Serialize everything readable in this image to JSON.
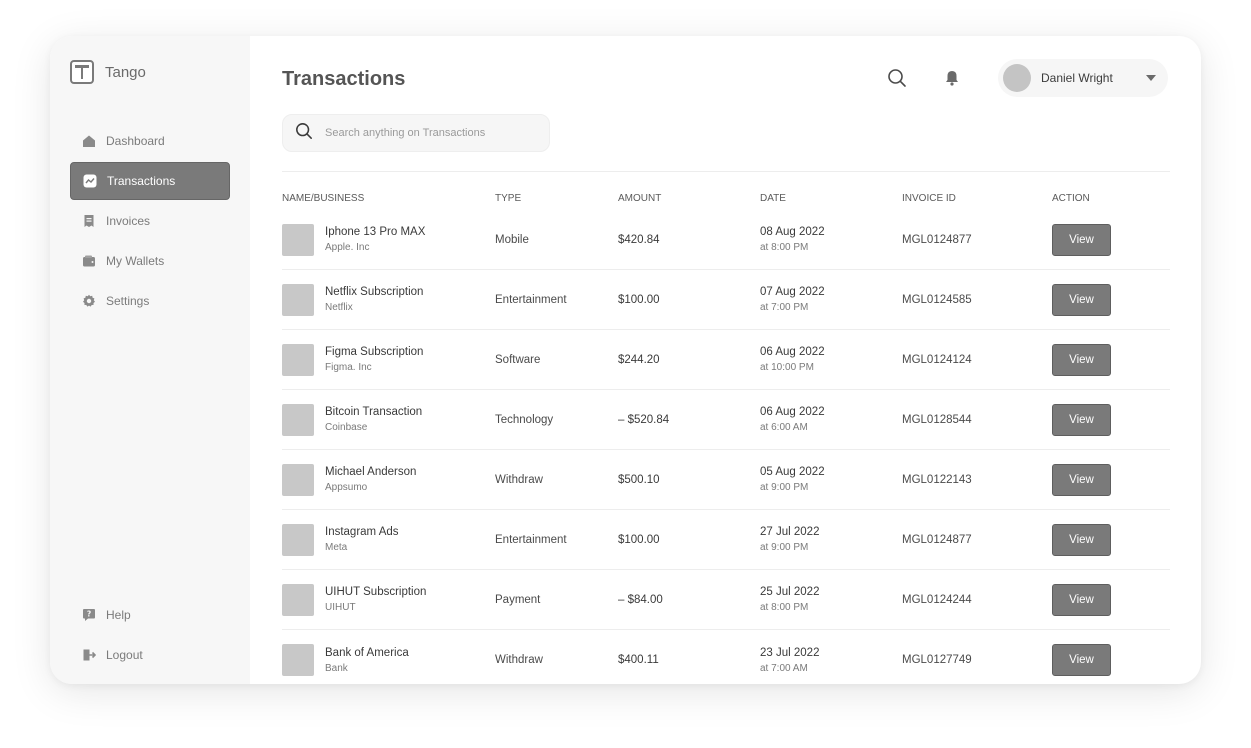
{
  "brand": {
    "name": "Tango"
  },
  "nav": {
    "items": [
      {
        "label": "Dashboard",
        "icon": "home-icon",
        "active": false
      },
      {
        "label": "Transactions",
        "icon": "trend-icon",
        "active": true
      },
      {
        "label": "Invoices",
        "icon": "receipt-icon",
        "active": false
      },
      {
        "label": "My Wallets",
        "icon": "wallet-icon",
        "active": false
      },
      {
        "label": "Settings",
        "icon": "gear-icon",
        "active": false
      }
    ],
    "bottom": [
      {
        "label": "Help",
        "icon": "help-icon"
      },
      {
        "label": "Logout",
        "icon": "logout-icon"
      }
    ]
  },
  "header": {
    "title": "Transactions",
    "user_name": "Daniel Wright"
  },
  "search": {
    "placeholder": "Search anything on Transactions",
    "value": ""
  },
  "table": {
    "headers": [
      "NAME/BUSINESS",
      "TYPE",
      "AMOUNT",
      "DATE",
      "INVOICE ID",
      "ACTION"
    ],
    "action_label": "View",
    "rows": [
      {
        "name": "Iphone 13 Pro MAX",
        "business": "Apple. Inc",
        "type": "Mobile",
        "amount": "$420.84",
        "date": "08 Aug 2022",
        "time": "at 8:00 PM",
        "invoice": "MGL0124877"
      },
      {
        "name": "Netflix Subscription",
        "business": "Netflix",
        "type": "Entertainment",
        "amount": "$100.00",
        "date": "07 Aug 2022",
        "time": "at 7:00 PM",
        "invoice": "MGL0124585"
      },
      {
        "name": "Figma Subscription",
        "business": "Figma. Inc",
        "type": "Software",
        "amount": "$244.20",
        "date": "06 Aug 2022",
        "time": "at 10:00 PM",
        "invoice": "MGL0124124"
      },
      {
        "name": "Bitcoin Transaction",
        "business": "Coinbase",
        "type": "Technology",
        "amount": "– $520.84",
        "date": "06 Aug 2022",
        "time": "at 6:00 AM",
        "invoice": "MGL0128544"
      },
      {
        "name": "Michael Anderson",
        "business": "Appsumo",
        "type": "Withdraw",
        "amount": "$500.10",
        "date": "05 Aug 2022",
        "time": "at 9:00 PM",
        "invoice": "MGL0122143"
      },
      {
        "name": "Instagram Ads",
        "business": "Meta",
        "type": "Entertainment",
        "amount": "$100.00",
        "date": "27 Jul 2022",
        "time": "at 9:00 PM",
        "invoice": "MGL0124877"
      },
      {
        "name": "UIHUT Subscription",
        "business": "UIHUT",
        "type": "Payment",
        "amount": "– $84.00",
        "date": "25 Jul 2022",
        "time": "at 8:00 PM",
        "invoice": "MGL0124244"
      },
      {
        "name": "Bank of America",
        "business": "Bank",
        "type": "Withdraw",
        "amount": "$400.11",
        "date": "23 Jul 2022",
        "time": "at 7:00 AM",
        "invoice": "MGL0127749"
      }
    ]
  }
}
